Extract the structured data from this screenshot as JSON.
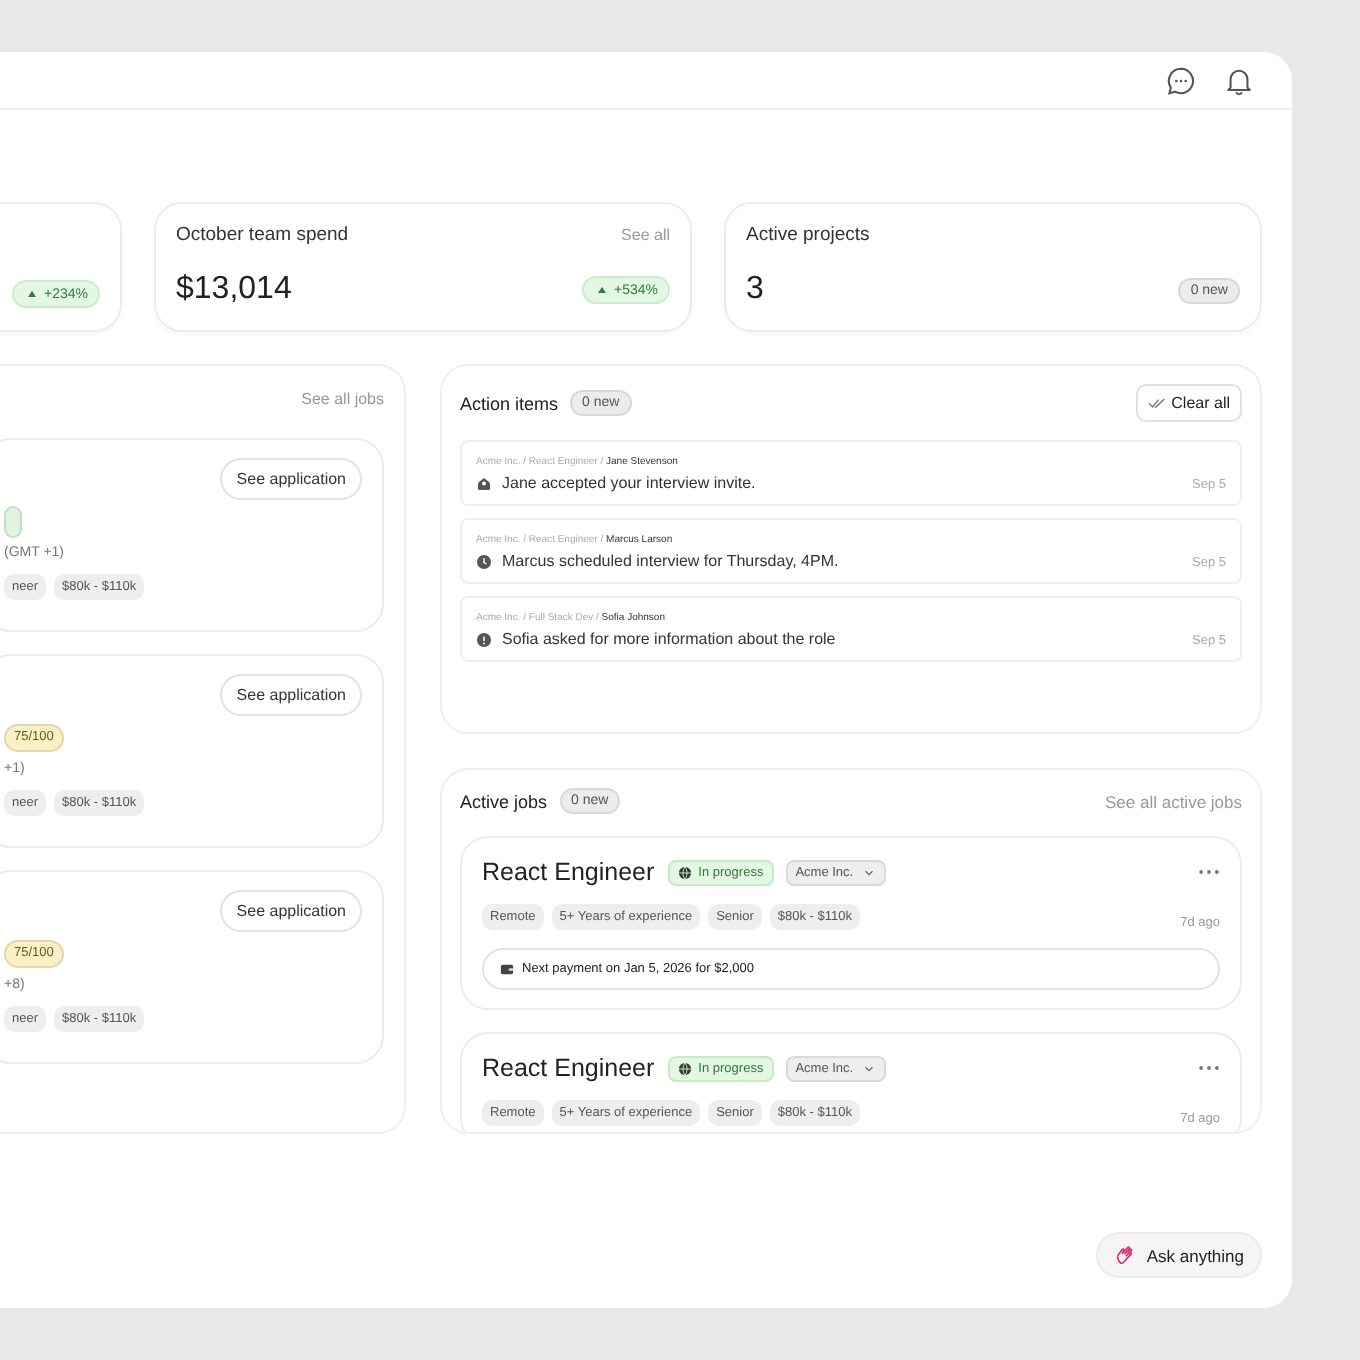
{
  "stats": [
    {
      "change": "+234%"
    },
    {
      "title": "October team spend",
      "link": "See all",
      "value": "$13,014",
      "change": "+534%"
    },
    {
      "title": "Active projects",
      "value": "3",
      "badge": "0 new"
    }
  ],
  "applications": {
    "link": "See all jobs",
    "items": [
      {
        "button": "See application",
        "score": {
          "color": "#dff5df"
        },
        "location": "(GMT +1)",
        "tags": [
          "neer",
          "$80k - $110k"
        ]
      },
      {
        "button": "See application",
        "score": {
          "color": "#fbf0c6",
          "text": "75/100"
        },
        "location": "+1)",
        "tags": [
          "neer",
          "$80k - $110k"
        ]
      },
      {
        "button": "See application",
        "score": {
          "color": "#fbf0c6",
          "text": "75/100"
        },
        "location": "+8)",
        "tags": [
          "neer",
          "$80k - $110k"
        ]
      }
    ]
  },
  "action_items": {
    "title": "Action items",
    "badge": "0 new",
    "clear": "Clear all",
    "items": [
      {
        "kind": "accepted",
        "path": "Acme Inc. / React Engineer / **Jane Stevenson**",
        "text": "Jane accepted your interview invite.",
        "date": "Sep 5"
      },
      {
        "kind": "scheduled",
        "path": "Acme Inc. / React Engineer / **Marcus Larson**",
        "text": "Marcus scheduled interview for Thursday, 4PM.",
        "date": "Sep 5"
      },
      {
        "kind": "question",
        "path": "Acme Inc. / Full Stack Dev / **Sofia Johnson**",
        "text": "Sofia asked for more information about the role",
        "date": "Sep 5"
      }
    ]
  },
  "active_jobs": {
    "title": "Active jobs",
    "badge": "0 new",
    "link": "See all active jobs",
    "items": [
      {
        "title": "React Engineer",
        "status": "In progress",
        "company": "Acme Inc.",
        "tags": [
          "Remote",
          "5+ Years of experience",
          "Senior",
          "$80k - $110k"
        ],
        "age": "7d ago",
        "payment": "Next payment on Jan 5, 2026 for $2,000"
      },
      {
        "title": "React Engineer",
        "status": "In progress",
        "company": "Acme Inc.",
        "tags": [
          "Remote",
          "5+ Years of experience",
          "Senior",
          "$80k - $110k"
        ],
        "age": "7d ago"
      }
    ]
  },
  "ask": "Ask anything"
}
